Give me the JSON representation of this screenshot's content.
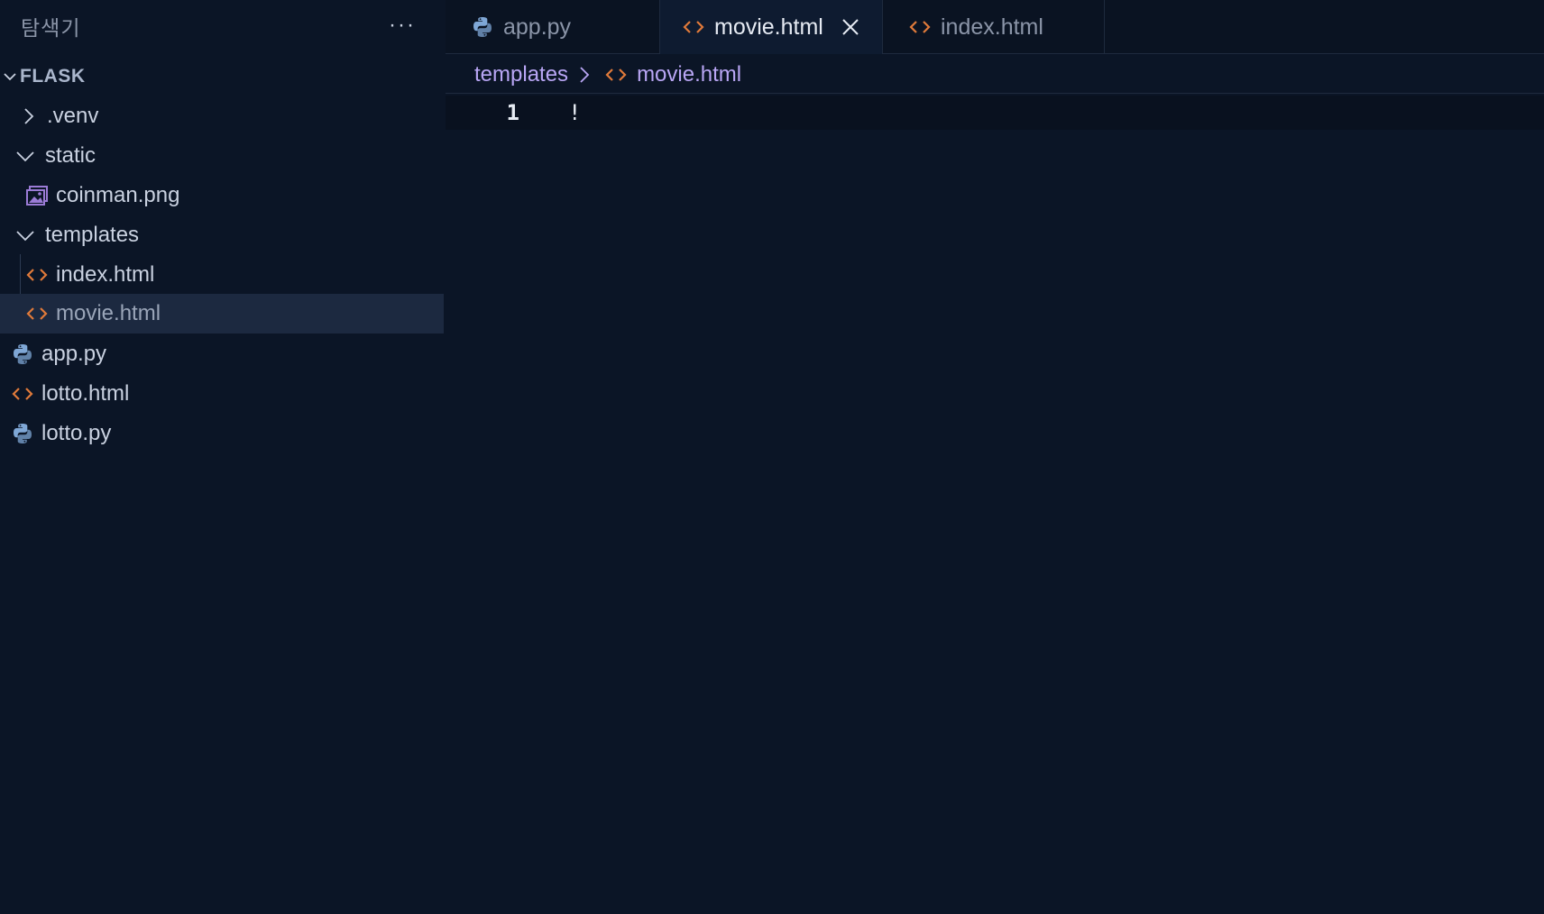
{
  "colors": {
    "background": "#0b1526",
    "html_icon": "#e07a3a",
    "python_icon": "#7fa7d6",
    "image_icon": "#9b7bd6",
    "breadcrumb_text": "#b9a6f5",
    "selected_row": "#1c2940"
  },
  "sidebar": {
    "title": "탐색기",
    "more_label": "···",
    "section": {
      "label": "FLASK",
      "expanded": true
    },
    "items": [
      {
        "label": ".venv",
        "type": "folder",
        "expanded": false,
        "icon": "chevron-right-icon"
      },
      {
        "label": "static",
        "type": "folder",
        "expanded": true,
        "icon": "chevron-down-icon"
      },
      {
        "label": "coinman.png",
        "type": "file",
        "icon": "image-file-icon"
      },
      {
        "label": "templates",
        "type": "folder",
        "expanded": true,
        "icon": "chevron-down-icon"
      },
      {
        "label": "index.html",
        "type": "file",
        "icon": "html-file-icon"
      },
      {
        "label": "movie.html",
        "type": "file",
        "icon": "html-file-icon",
        "selected": true
      },
      {
        "label": "app.py",
        "type": "file",
        "icon": "python-file-icon"
      },
      {
        "label": "lotto.html",
        "type": "file",
        "icon": "html-file-icon"
      },
      {
        "label": "lotto.py",
        "type": "file",
        "icon": "python-file-icon"
      }
    ]
  },
  "tabs": [
    {
      "label": "app.py",
      "icon": "python-file-icon",
      "active": false
    },
    {
      "label": "movie.html",
      "icon": "html-file-icon",
      "active": true,
      "close_icon": "close-icon"
    },
    {
      "label": "index.html",
      "icon": "html-file-icon",
      "active": false
    }
  ],
  "breadcrumb": {
    "folder": "templates",
    "file": "movie.html"
  },
  "editor": {
    "lines": [
      {
        "number": "1",
        "text": "!"
      }
    ]
  }
}
